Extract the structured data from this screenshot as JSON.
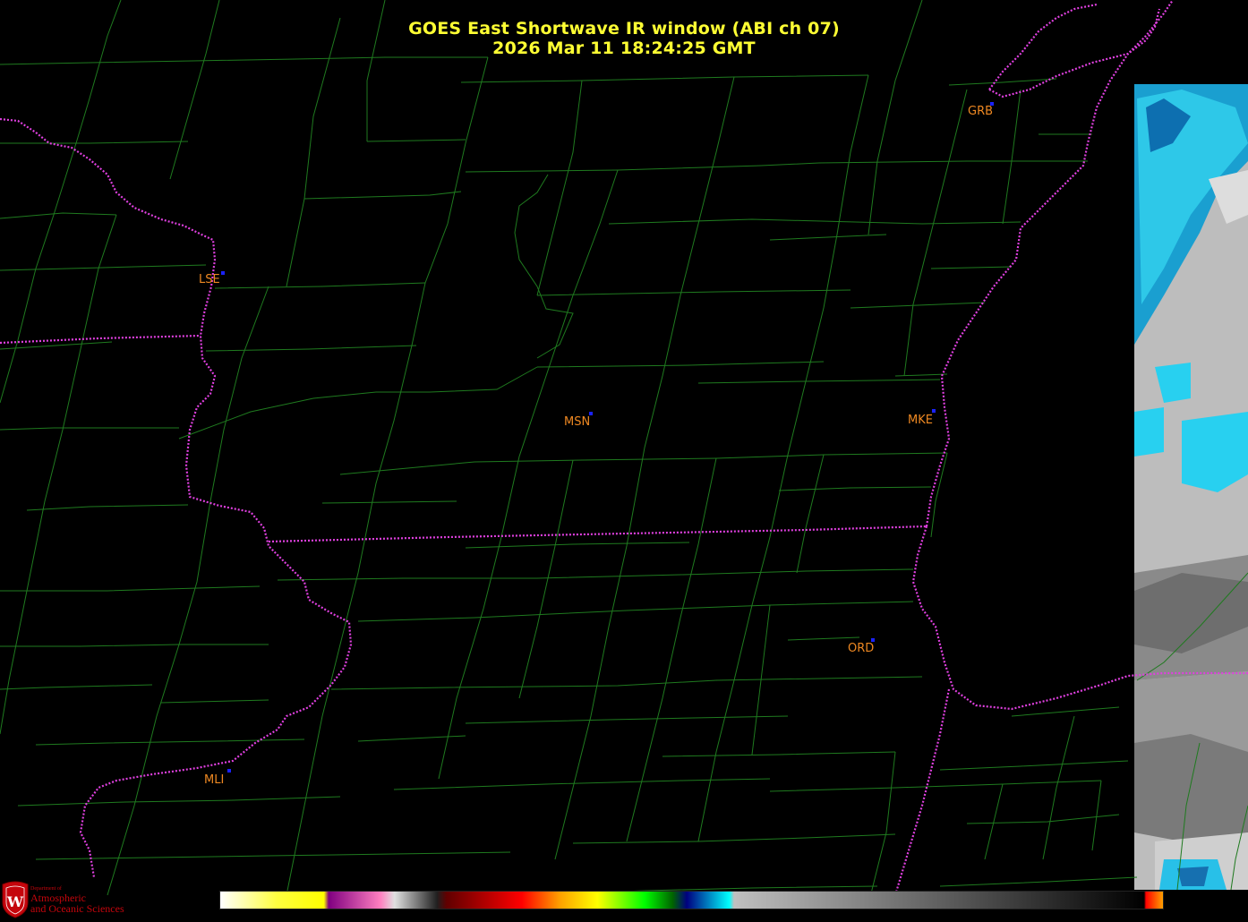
{
  "title": {
    "line1": "GOES East Shortwave IR window (ABI ch 07)",
    "line2": "2026 Mar 11  18:24:25 GMT"
  },
  "stations": [
    {
      "id": "GRB"
    },
    {
      "id": "LSE"
    },
    {
      "id": "MSN"
    },
    {
      "id": "MKE"
    },
    {
      "id": "ORD"
    },
    {
      "id": "MLI"
    }
  ],
  "logo": {
    "dept": "Department of",
    "line1": "Atmospheric",
    "line2": "and Oceanic Sciences",
    "seal_letter": "W"
  },
  "colors": {
    "title": "#ffff33",
    "station_label": "#ee8822",
    "station_dot": "#1a22ff",
    "county_lines": "#1f7a1f",
    "state_borders": "#e040e0",
    "logo": "#c5050c"
  },
  "colorbar": {
    "stops": [
      "#ffffff",
      "#ffff40",
      "#ffff00",
      "#800080",
      "#ff80c0",
      "#e0e0e0",
      "#202020",
      "#600000",
      "#ff0000",
      "#ffa000",
      "#ffff00",
      "#00ff00",
      "#006400",
      "#000080",
      "#00ffff",
      "#c0c0c0",
      "#000000",
      "#ff0000",
      "#ffa000"
    ]
  }
}
